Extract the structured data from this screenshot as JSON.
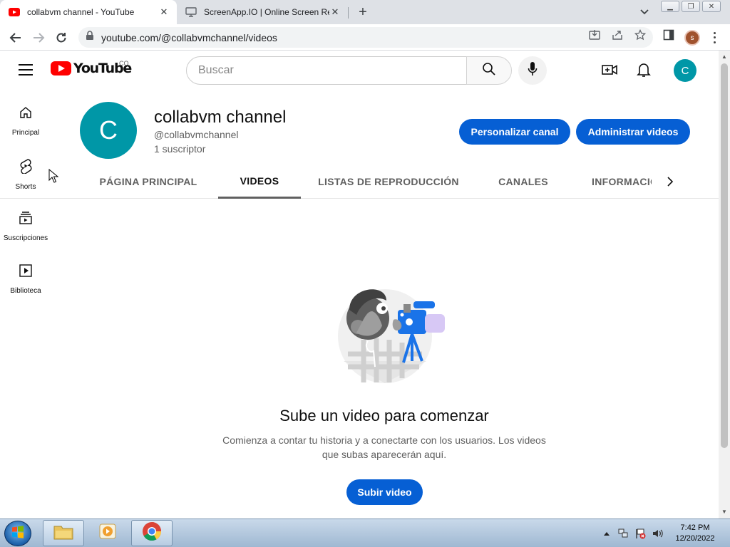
{
  "browser": {
    "tabs": [
      {
        "title": "collabvm channel - YouTube",
        "active": true
      },
      {
        "title": "ScreenApp.IO | Online Screen Re",
        "active": false
      }
    ],
    "new_tab_label": "+",
    "url": "youtube.com/@collabvmchannel/videos",
    "profile_initial": "s"
  },
  "masthead": {
    "logo_text": "YouTube",
    "country_code": "CO",
    "search_placeholder": "Buscar",
    "avatar_initial": "C"
  },
  "guide": [
    {
      "label": "Principal",
      "icon": "home-icon"
    },
    {
      "label": "Shorts",
      "icon": "shorts-icon"
    },
    {
      "label": "Suscripciones",
      "icon": "subscriptions-icon"
    },
    {
      "label": "Biblioteca",
      "icon": "library-icon"
    }
  ],
  "channel": {
    "avatar_initial": "C",
    "name": "collabvm channel",
    "handle": "@collabvmchannel",
    "subscribers": "1 suscriptor",
    "customize_button": "Personalizar canal",
    "manage_button": "Administrar videos"
  },
  "channel_tabs": [
    {
      "label": "PÁGINA PRINCIPAL",
      "selected": false
    },
    {
      "label": "VIDEOS",
      "selected": true
    },
    {
      "label": "LISTAS DE REPRODUCCIÓN",
      "selected": false
    },
    {
      "label": "CANALES",
      "selected": false
    },
    {
      "label": "INFORMACIÓN",
      "selected": false
    }
  ],
  "empty_state": {
    "title": "Sube un video para comenzar",
    "description": "Comienza a contar tu historia y a conectarte con los usuarios. Los videos que subas aparecerán aquí.",
    "upload_button": "Subir video"
  },
  "taskbar": {
    "time": "7:42 PM",
    "date": "12/20/2022"
  },
  "colors": {
    "accent_blue": "#065fd4",
    "avatar_teal": "#0097a7",
    "youtube_red": "#ff0000"
  }
}
